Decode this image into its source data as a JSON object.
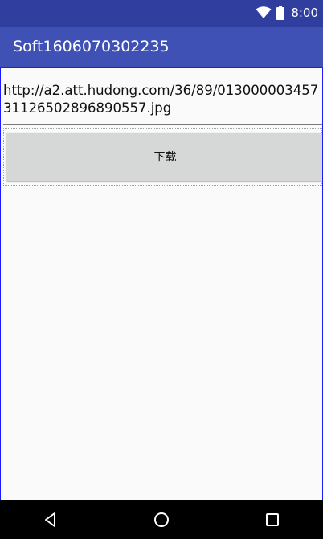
{
  "status_bar": {
    "time": "8:00",
    "icons": [
      "wifi-icon",
      "battery-icon"
    ]
  },
  "app_bar": {
    "title": "Soft1606070302235"
  },
  "main": {
    "url_value": "http://a2.att.hudong.com/36/89/01300000345731126502896890557.jpg",
    "download_label": "下载"
  },
  "nav_bar": {
    "icons": [
      "back-icon",
      "home-icon",
      "recents-icon"
    ]
  },
  "colors": {
    "status_bar": "#303f9f",
    "app_bar": "#3f51b5",
    "button": "#d6d7d7",
    "frame_border": "#1a1aff"
  }
}
